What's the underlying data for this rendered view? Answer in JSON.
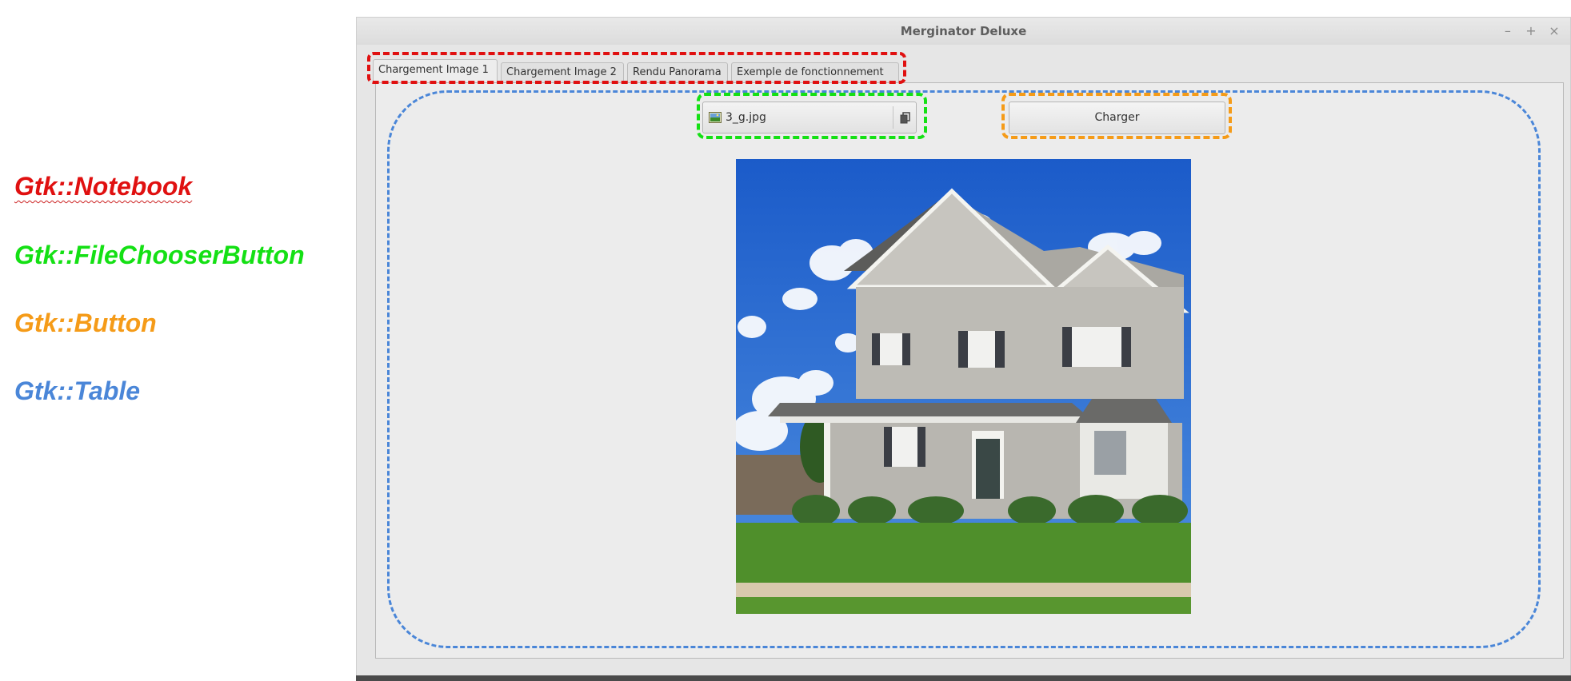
{
  "legend": [
    {
      "label": "Gtk::Notebook",
      "color": "#e01010"
    },
    {
      "label": "Gtk::FileChooserButton",
      "color": "#14e014"
    },
    {
      "label": "Gtk::Button",
      "color": "#f59b18"
    },
    {
      "label": "Gtk::Table",
      "color": "#4a86d8"
    }
  ],
  "window": {
    "title": "Merginator Deluxe",
    "controls": [
      "–",
      "+",
      "×"
    ]
  },
  "notebook": {
    "tabs": [
      {
        "label": "Chargement Image 1",
        "active": true
      },
      {
        "label": "Chargement Image 2",
        "active": false
      },
      {
        "label": "Rendu Panorama",
        "active": false
      },
      {
        "label": "Exemple de fonctionnement",
        "active": false
      }
    ]
  },
  "filechooser": {
    "filename": "3_g.jpg",
    "icon": "image-file-icon",
    "open_icon": "folder-open-icon"
  },
  "charger_button": {
    "label": "Charger"
  },
  "image": {
    "subject": "house-photo"
  }
}
